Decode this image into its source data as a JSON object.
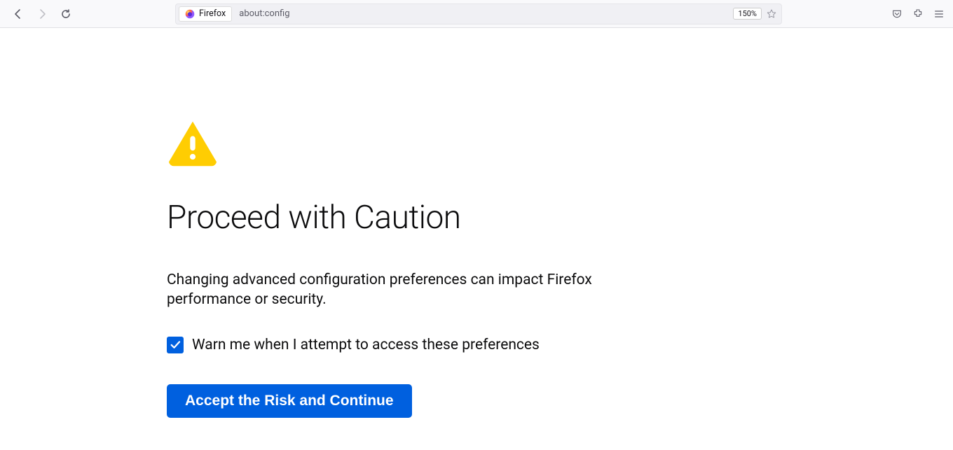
{
  "chrome": {
    "identity_label": "Firefox",
    "url_text": "about:config",
    "zoom_label": "150%"
  },
  "main": {
    "heading": "Proceed with Caution",
    "description": "Changing advanced configuration preferences can impact Firefox performance or security.",
    "checkbox_label": "Warn me when I attempt to access these preferences",
    "checkbox_checked": true,
    "accept_button_label": "Accept the Risk and Continue"
  }
}
